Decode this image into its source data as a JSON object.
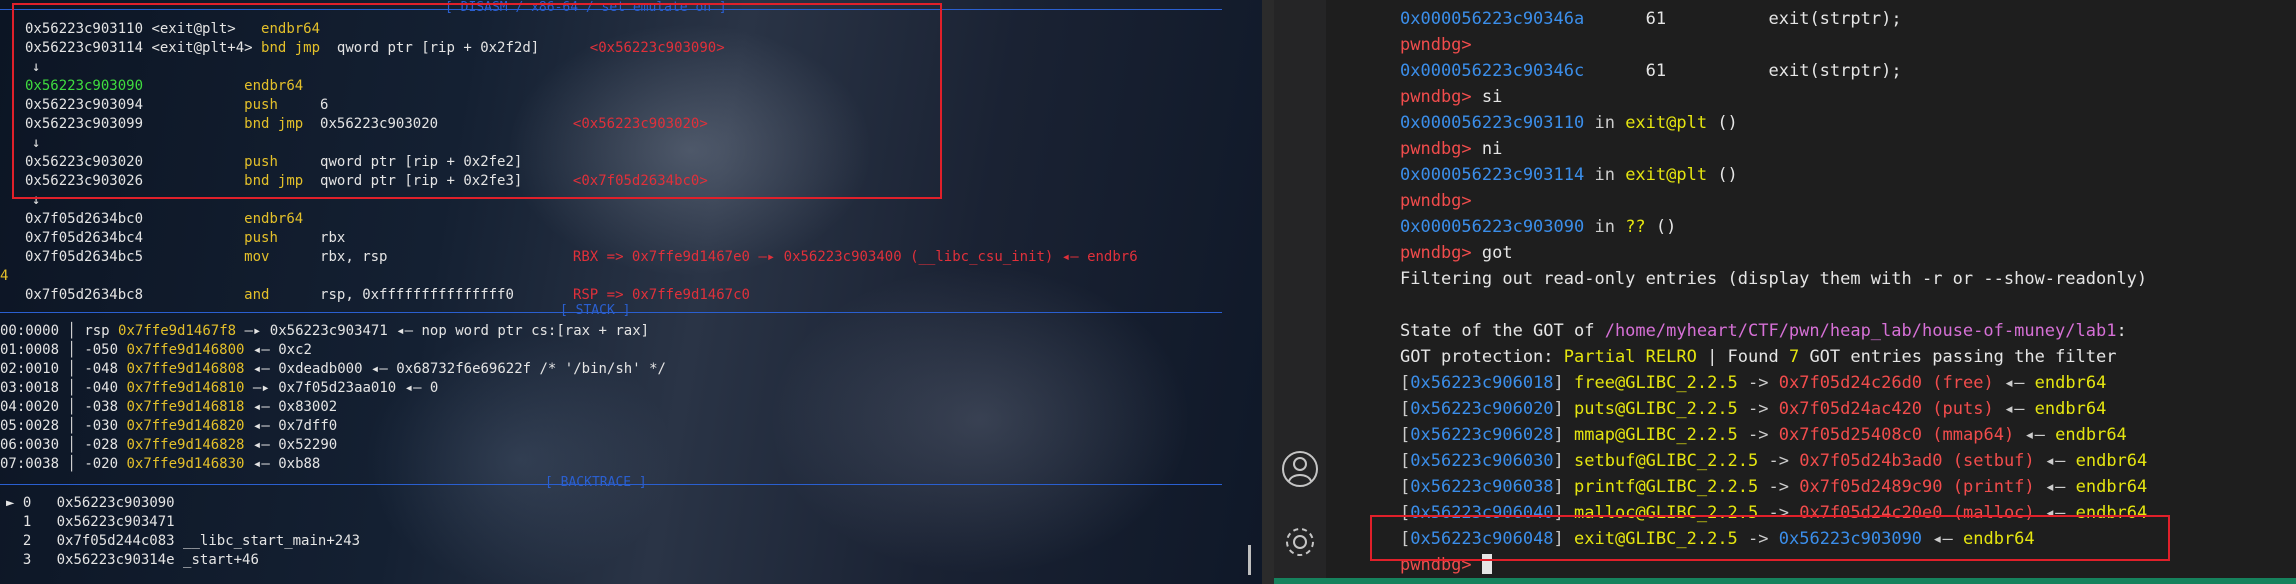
{
  "left_pane": {
    "disasm_header": "[ DISASM / x86-64 / set emulate on ]",
    "disasm": [
      {
        "addr": "0x56223c903110",
        "sym": " <exit@plt>  ",
        "addr_color": "white",
        "mnem": "endbr64",
        "ops": "",
        "target": ""
      },
      {
        "addr": "0x56223c903114",
        "sym": " <exit@plt+4>",
        "addr_color": "white",
        "mnem": "bnd jmp",
        "ops": "qword ptr [rip + 0x2f2d]",
        "target": "<0x56223c903090>"
      },
      {
        "addr": "",
        "sym": "",
        "addr_color": "white",
        "mnem": "",
        "ops": "",
        "target": "",
        "arrow": "↓"
      },
      {
        "addr": "0x56223c903090",
        "sym": "",
        "addr_color": "green",
        "mnem": "endbr64",
        "ops": "",
        "target": ""
      },
      {
        "addr": "0x56223c903094",
        "sym": "",
        "addr_color": "white",
        "mnem": "push",
        "ops": "6",
        "target": ""
      },
      {
        "addr": "0x56223c903099",
        "sym": "",
        "addr_color": "white",
        "mnem": "bnd jmp",
        "ops": "0x56223c903020",
        "target": "<0x56223c903020>"
      },
      {
        "addr": "",
        "sym": "",
        "addr_color": "white",
        "mnem": "",
        "ops": "",
        "target": "",
        "arrow": "↓"
      },
      {
        "addr": "0x56223c903020",
        "sym": "",
        "addr_color": "white",
        "mnem": "push",
        "ops": "qword ptr [rip + 0x2fe2]",
        "target": ""
      },
      {
        "addr": "0x56223c903026",
        "sym": "",
        "addr_color": "white",
        "mnem": "bnd jmp",
        "ops": "qword ptr [rip + 0x2fe3]",
        "target": "<0x7f05d2634bc0>"
      },
      {
        "addr": "",
        "sym": "",
        "addr_color": "white",
        "mnem": "",
        "ops": "",
        "target": "",
        "arrow": "↓"
      },
      {
        "addr": "0x7f05d2634bc0",
        "sym": "",
        "addr_color": "white",
        "mnem": "endbr64",
        "ops": "",
        "target": ""
      },
      {
        "addr": "0x7f05d2634bc4",
        "sym": "",
        "addr_color": "white",
        "mnem": "push",
        "ops": "rbx",
        "target": ""
      },
      {
        "addr": "0x7f05d2634bc5",
        "sym": "",
        "addr_color": "white",
        "mnem": "mov",
        "ops": "rbx, rsp",
        "target": "RBX => 0x7ffe9d1467e0 —▸ 0x56223c903400 (__libc_csu_init) ◂— endbr6"
      },
      {
        "addr": "",
        "sym": "",
        "addr_color": "white",
        "mnem": "",
        "ops": "",
        "target": "",
        "wrap": "4"
      },
      {
        "addr": "0x7f05d2634bc8",
        "sym": "",
        "addr_color": "white",
        "mnem": "and",
        "ops": "rsp, 0xfffffffffffffff0",
        "target": "RSP => 0x7ffe9d1467c0"
      }
    ],
    "stack_header": "[ STACK ]",
    "stack": [
      {
        "idx": "00:0000",
        "reg": "rsp",
        "addr": "0x7ffe9d1467f8",
        "rest": "—▸ 0x56223c903471 ◂— nop word ptr cs:[rax + rax]"
      },
      {
        "idx": "01:0008",
        "reg": "-050",
        "addr": "0x7ffe9d146800",
        "rest": "◂— 0xc2"
      },
      {
        "idx": "02:0010",
        "reg": "-048",
        "addr": "0x7ffe9d146808",
        "rest": "◂— 0xdeadb000 ◂— 0x68732f6e69622f /* '/bin/sh' */"
      },
      {
        "idx": "03:0018",
        "reg": "-040",
        "addr": "0x7ffe9d146810",
        "rest": "—▸ 0x7f05d23aa010 ◂— 0"
      },
      {
        "idx": "04:0020",
        "reg": "-038",
        "addr": "0x7ffe9d146818",
        "rest": "◂— 0x83002"
      },
      {
        "idx": "05:0028",
        "reg": "-030",
        "addr": "0x7ffe9d146820",
        "rest": "◂— 0x7dff0"
      },
      {
        "idx": "06:0030",
        "reg": "-028",
        "addr": "0x7ffe9d146828",
        "rest": "◂— 0x52290"
      },
      {
        "idx": "07:0038",
        "reg": "-020",
        "addr": "0x7ffe9d146830",
        "rest": "◂— 0xb88"
      }
    ],
    "backtrace_header": "[ BACKTRACE ]",
    "backtrace": [
      {
        "mark": "►",
        "n": "0",
        "addr": "0x56223c903090",
        "sym": ""
      },
      {
        "mark": "",
        "n": "1",
        "addr": "0x56223c903471",
        "sym": ""
      },
      {
        "mark": "",
        "n": "2",
        "addr": "0x7f05d244c083",
        "sym": "__libc_start_main+243"
      },
      {
        "mark": "",
        "n": "3",
        "addr": "0x56223c90314e",
        "sym": "_start+46"
      }
    ]
  },
  "right_pane": {
    "lines": [
      {
        "type": "src",
        "addr": "0x000056223c90346a",
        "line": "61",
        "code": "exit(strptr);"
      },
      {
        "type": "prompt",
        "text": ""
      },
      {
        "type": "src",
        "addr": "0x000056223c90346c",
        "line": "61",
        "code": "exit(strptr);"
      },
      {
        "type": "prompt",
        "text": "si"
      },
      {
        "type": "frame",
        "addr": "0x000056223c903110",
        "fn": "exit@plt",
        "args": " ()"
      },
      {
        "type": "prompt",
        "text": "ni"
      },
      {
        "type": "frame",
        "addr": "0x000056223c903114",
        "fn": "exit@plt",
        "args": " ()"
      },
      {
        "type": "prompt",
        "text": ""
      },
      {
        "type": "frame",
        "addr": "0x000056223c903090",
        "fn": "??",
        "args": " ()"
      },
      {
        "type": "prompt",
        "text": "got"
      },
      {
        "type": "plain",
        "text": "Filtering out read-only entries (display them with -r or --show-readonly)"
      },
      {
        "type": "plain",
        "text": ""
      },
      {
        "type": "state",
        "pre": "State of the GOT of ",
        "path": "/home/myheart/CTF/pwn/heap_lab/house-of-muney/lab1",
        "post": ":"
      },
      {
        "type": "prot",
        "pre": "GOT protection: ",
        "relro": "Partial RELRO",
        "mid": " | Found ",
        "count": "7",
        "post": " GOT entries passing the filter"
      }
    ],
    "prompt": "pwndbg>",
    "got": [
      {
        "slot": "0x56223c906018",
        "name": "free@GLIBC_2.2.5",
        "target": "0x7f05d24c26d0",
        "fn": "(free)",
        "insn": "endbr64"
      },
      {
        "slot": "0x56223c906020",
        "name": "puts@GLIBC_2.2.5",
        "target": "0x7f05d24ac420",
        "fn": "(puts)",
        "insn": "endbr64"
      },
      {
        "slot": "0x56223c906028",
        "name": "mmap@GLIBC_2.2.5",
        "target": "0x7f05d25408c0",
        "fn": "(mmap64)",
        "insn": "endbr64"
      },
      {
        "slot": "0x56223c906030",
        "name": "setbuf@GLIBC_2.2.5",
        "target": "0x7f05d24b3ad0",
        "fn": "(setbuf)",
        "insn": "endbr64"
      },
      {
        "slot": "0x56223c906038",
        "name": "printf@GLIBC_2.2.5",
        "target": "0x7f05d2489c90",
        "fn": "(printf)",
        "insn": "endbr64"
      },
      {
        "slot": "0x56223c906040",
        "name": "malloc@GLIBC_2.2.5",
        "target": "0x7f05d24c20e0",
        "fn": "(malloc)",
        "insn": "endbr64"
      },
      {
        "slot": "0x56223c906048",
        "name": "exit@GLIBC_2.2.5",
        "target": "0x56223c903090",
        "fn": "",
        "insn": "endbr64"
      }
    ]
  },
  "colors": {
    "accent_red": "#e0202a",
    "pwndbg_red": "#f14c4c",
    "addr_blue": "#3b8eea",
    "sym_yellow": "#e5e510",
    "path_purple": "#d670d6"
  }
}
